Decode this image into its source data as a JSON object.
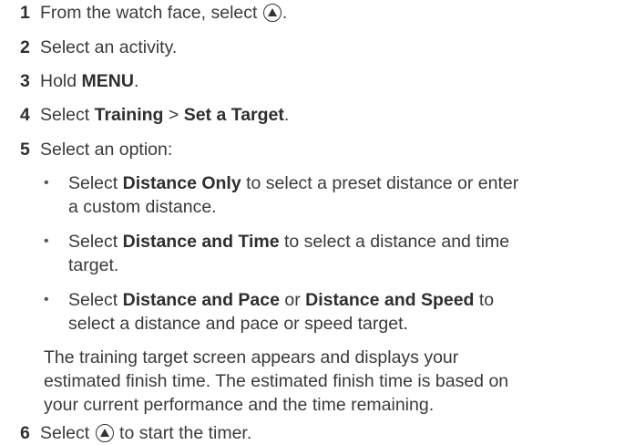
{
  "steps": [
    {
      "num": "1",
      "pre": "From the watch face, select",
      "post": "."
    },
    {
      "num": "2",
      "text": "Select an activity."
    },
    {
      "num": "3",
      "pre": "Hold ",
      "bold": "MENU",
      "post": "."
    },
    {
      "num": "4",
      "pre": "Select ",
      "bold": "Training",
      "mid": " > ",
      "bold2": "Set a Target",
      "post": "."
    },
    {
      "num": "5",
      "text": "Select an option:"
    },
    {
      "num": "6",
      "pre": "Select",
      "post": "to start the timer."
    }
  ],
  "options": [
    {
      "pre": "Select ",
      "bold": "Distance Only",
      "post": " to select a preset distance or enter",
      "line2": "a custom distance."
    },
    {
      "pre": "Select ",
      "bold": "Distance and Time",
      "post": " to select a distance and time",
      "line2": "target."
    },
    {
      "pre": "Select ",
      "bold": "Distance and Pace",
      "mid": " or ",
      "bold2": "Distance and Speed",
      "post": " to",
      "line2": "select a distance and pace or speed target."
    }
  ],
  "note": {
    "line1": "The training target screen appears and displays your",
    "line2": "estimated finish time. The estimated finish time is based on",
    "line3": "your current performance and the time remaining."
  },
  "icons": {
    "start_button": "up-button-icon"
  }
}
